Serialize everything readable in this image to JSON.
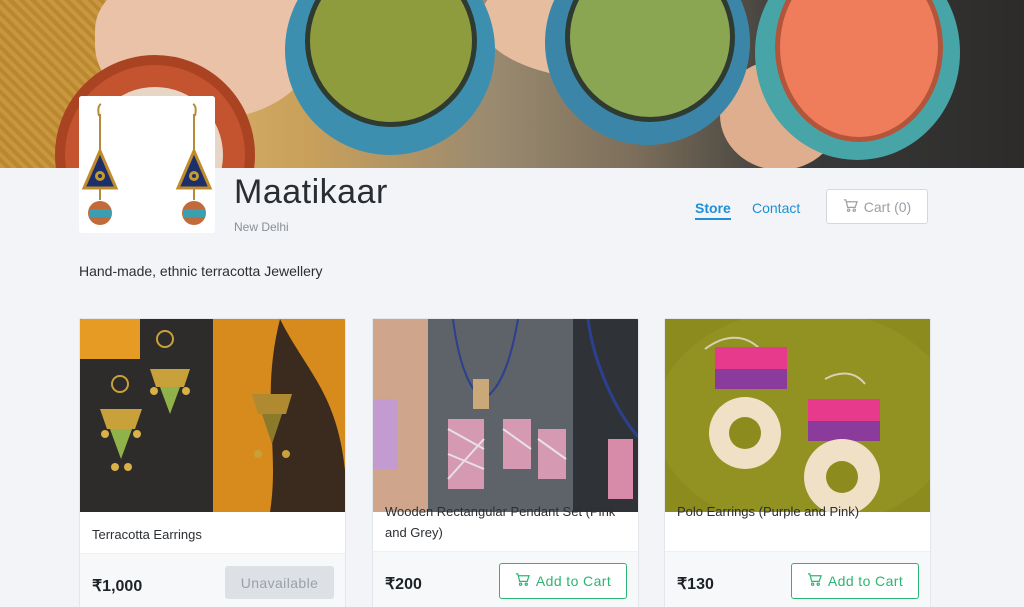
{
  "store": {
    "name": "Maatikaar",
    "location": "New Delhi",
    "tagline": "Hand-made, ethnic terracotta Jewellery"
  },
  "nav": {
    "store_label": "Store",
    "contact_label": "Contact",
    "cart_label": "Cart (0)"
  },
  "products": [
    {
      "title": "Terracotta Earrings",
      "price": "₹1,000",
      "action": "Unavailable"
    },
    {
      "title": "Wooden Rectangular Pendant Set (Pink and Grey)",
      "price": "₹200",
      "action": "Add to Cart"
    },
    {
      "title": "Polo Earrings (Purple and Pink)",
      "price": "₹130",
      "action": "Add to Cart"
    }
  ],
  "colors": {
    "link": "#1f8fd6",
    "add_to_cart": "#2bb673",
    "background": "#f2f4f7"
  }
}
